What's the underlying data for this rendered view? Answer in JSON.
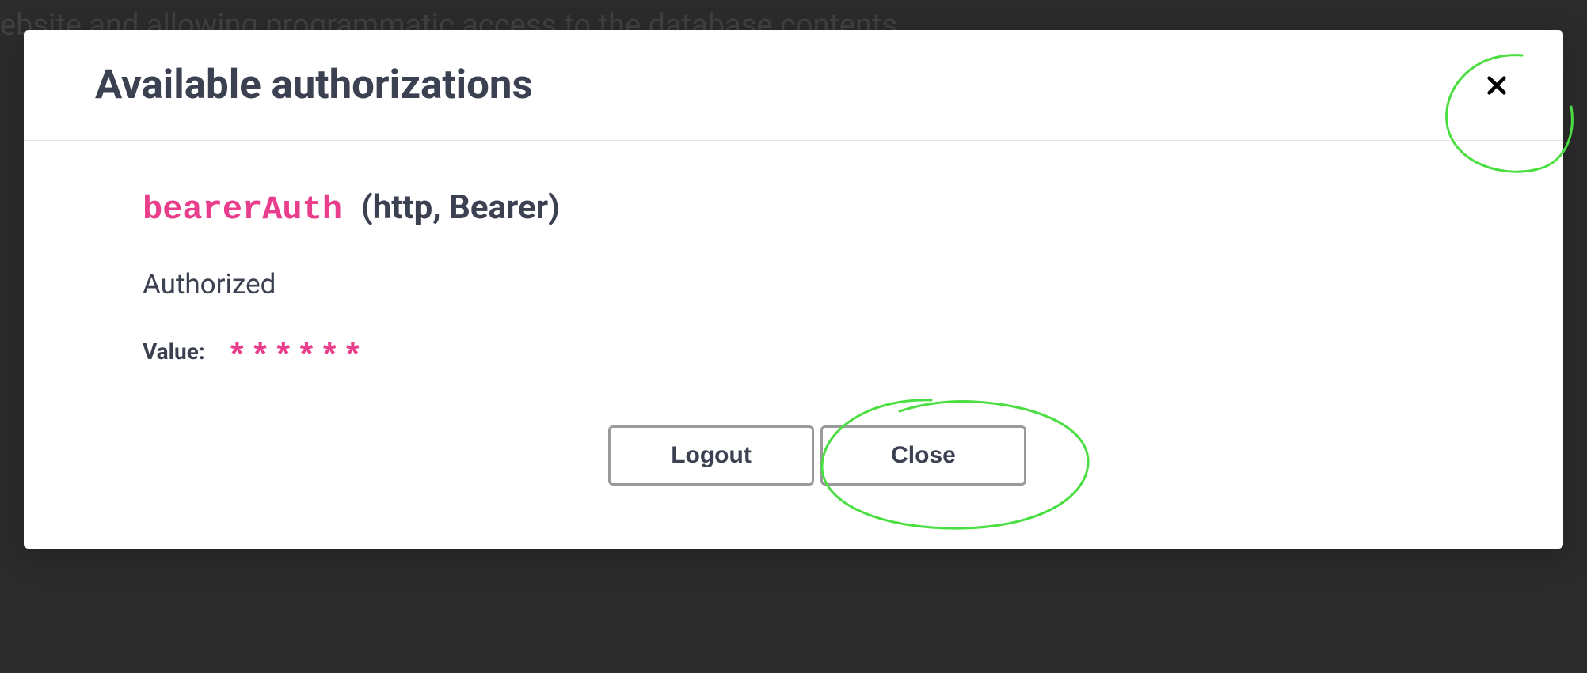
{
  "background": {
    "text": "ebsite and allowing programmatic access to the database contents."
  },
  "modal": {
    "title": "Available authorizations",
    "auth": {
      "name": "bearerAuth",
      "type": "(http, Bearer)",
      "status": "Authorized",
      "value_label": "Value:",
      "value_masked": "******"
    },
    "buttons": {
      "logout": "Logout",
      "close": "Close"
    }
  }
}
